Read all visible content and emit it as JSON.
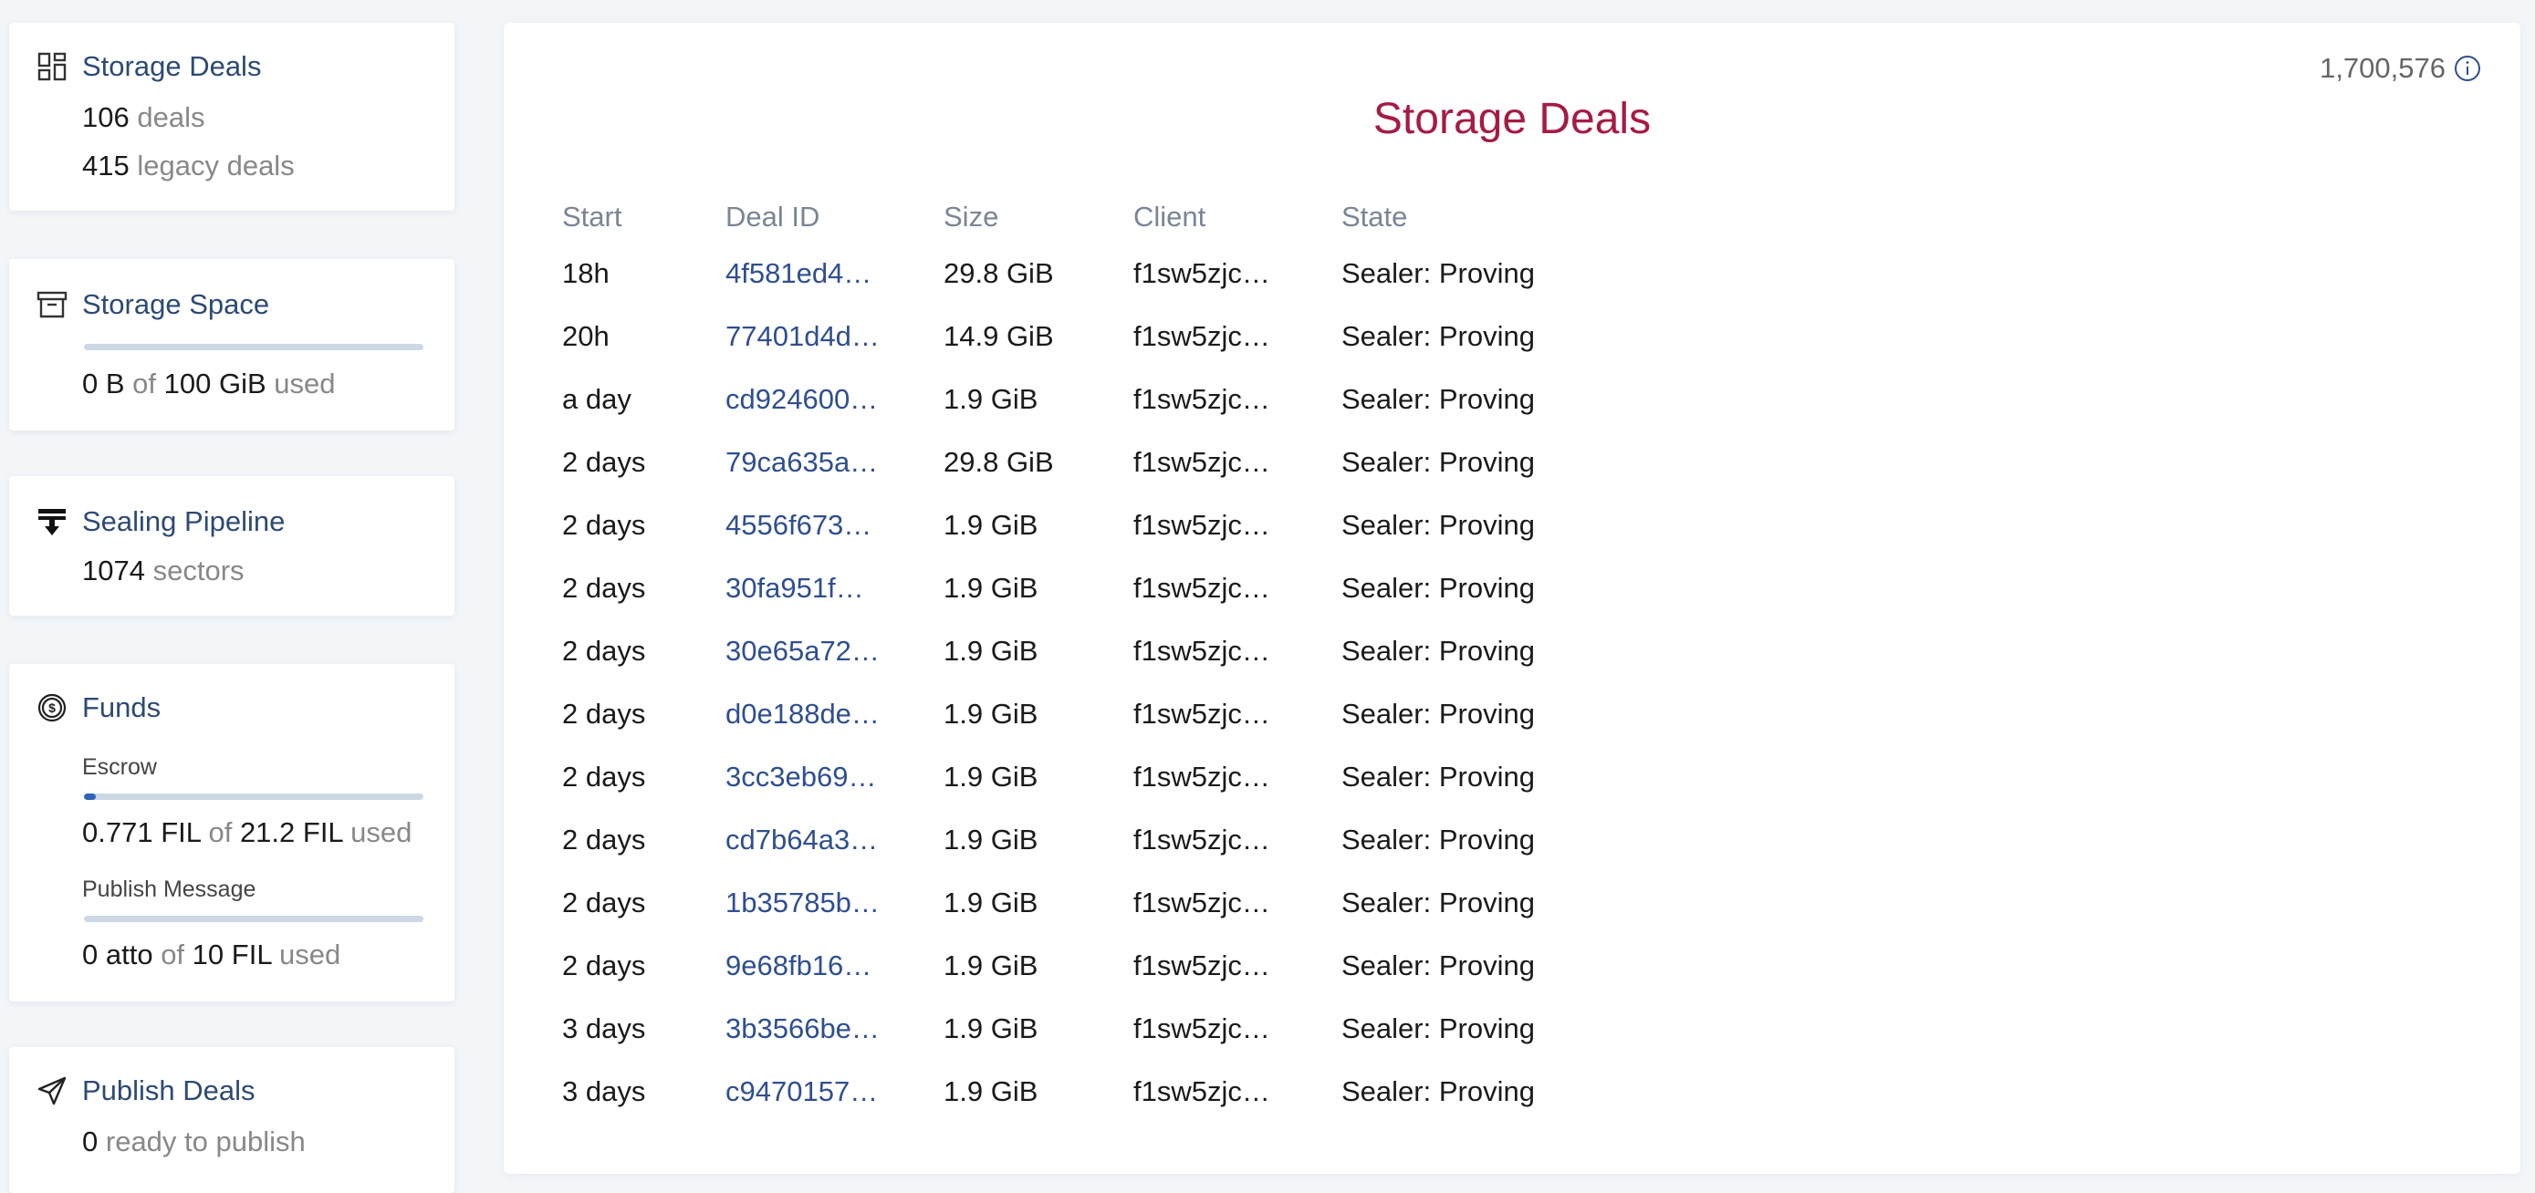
{
  "sidebar": {
    "storage_deals": {
      "icon": "grid-icon",
      "title": "Storage Deals",
      "deals_count": "106",
      "deals_label": "deals",
      "legacy_count": "415",
      "legacy_label": "legacy deals"
    },
    "storage_space": {
      "icon": "archive-box-icon",
      "title": "Storage Space",
      "used": "0 B",
      "of": "of",
      "total": "100 GiB",
      "used_label": "used",
      "fraction_used": 0
    },
    "sealing_pipeline": {
      "icon": "pipeline-icon",
      "title": "Sealing Pipeline",
      "count": "1074",
      "count_label": "sectors"
    },
    "funds": {
      "icon": "dollar-coin-icon",
      "title": "Funds",
      "escrow_label": "Escrow",
      "escrow_used": "0.771 FIL",
      "escrow_of": "of",
      "escrow_total": "21.2 FIL",
      "escrow_used_label": "used",
      "escrow_fraction": 0.036,
      "publish_label": "Publish Message",
      "publish_used": "0 atto",
      "publish_of": "of",
      "publish_total": "10 FIL",
      "publish_used_label": "used",
      "publish_fraction": 0
    },
    "publish_deals": {
      "icon": "paper-plane-icon",
      "title": "Publish Deals",
      "count": "0",
      "count_label": "ready to publish"
    }
  },
  "main": {
    "epoch": "1,700,576",
    "title": "Storage Deals",
    "columns": [
      "Start",
      "Deal ID",
      "Size",
      "Client",
      "State"
    ],
    "rows": [
      {
        "start": "18h",
        "deal_id": "4f581ed4…",
        "size": "29.8 GiB",
        "client": "f1sw5zjc…",
        "state": "Sealer: Proving"
      },
      {
        "start": "20h",
        "deal_id": "77401d4d…",
        "size": "14.9 GiB",
        "client": "f1sw5zjc…",
        "state": "Sealer: Proving"
      },
      {
        "start": "a day",
        "deal_id": "cd924600…",
        "size": "1.9 GiB",
        "client": "f1sw5zjc…",
        "state": "Sealer: Proving"
      },
      {
        "start": "2 days",
        "deal_id": "79ca635a…",
        "size": "29.8 GiB",
        "client": "f1sw5zjc…",
        "state": "Sealer: Proving"
      },
      {
        "start": "2 days",
        "deal_id": "4556f673…",
        "size": "1.9 GiB",
        "client": "f1sw5zjc…",
        "state": "Sealer: Proving"
      },
      {
        "start": "2 days",
        "deal_id": "30fa951f…",
        "size": "1.9 GiB",
        "client": "f1sw5zjc…",
        "state": "Sealer: Proving"
      },
      {
        "start": "2 days",
        "deal_id": "30e65a72…",
        "size": "1.9 GiB",
        "client": "f1sw5zjc…",
        "state": "Sealer: Proving"
      },
      {
        "start": "2 days",
        "deal_id": "d0e188de…",
        "size": "1.9 GiB",
        "client": "f1sw5zjc…",
        "state": "Sealer: Proving"
      },
      {
        "start": "2 days",
        "deal_id": "3cc3eb69…",
        "size": "1.9 GiB",
        "client": "f1sw5zjc…",
        "state": "Sealer: Proving"
      },
      {
        "start": "2 days",
        "deal_id": "cd7b64a3…",
        "size": "1.9 GiB",
        "client": "f1sw5zjc…",
        "state": "Sealer: Proving"
      },
      {
        "start": "2 days",
        "deal_id": "1b35785b…",
        "size": "1.9 GiB",
        "client": "f1sw5zjc…",
        "state": "Sealer: Proving"
      },
      {
        "start": "2 days",
        "deal_id": "9e68fb16…",
        "size": "1.9 GiB",
        "client": "f1sw5zjc…",
        "state": "Sealer: Proving"
      },
      {
        "start": "3 days",
        "deal_id": "3b3566be…",
        "size": "1.9 GiB",
        "client": "f1sw5zjc…",
        "state": "Sealer: Proving"
      },
      {
        "start": "3 days",
        "deal_id": "c9470157…",
        "size": "1.9 GiB",
        "client": "f1sw5zjc…",
        "state": "Sealer: Proving"
      }
    ]
  },
  "colors": {
    "title_accent": "#a61b43",
    "link": "#2f4f8f",
    "card_title": "#2d4a73",
    "bar_track": "#cdd8e5",
    "bar_fill": "#2f63b5"
  }
}
